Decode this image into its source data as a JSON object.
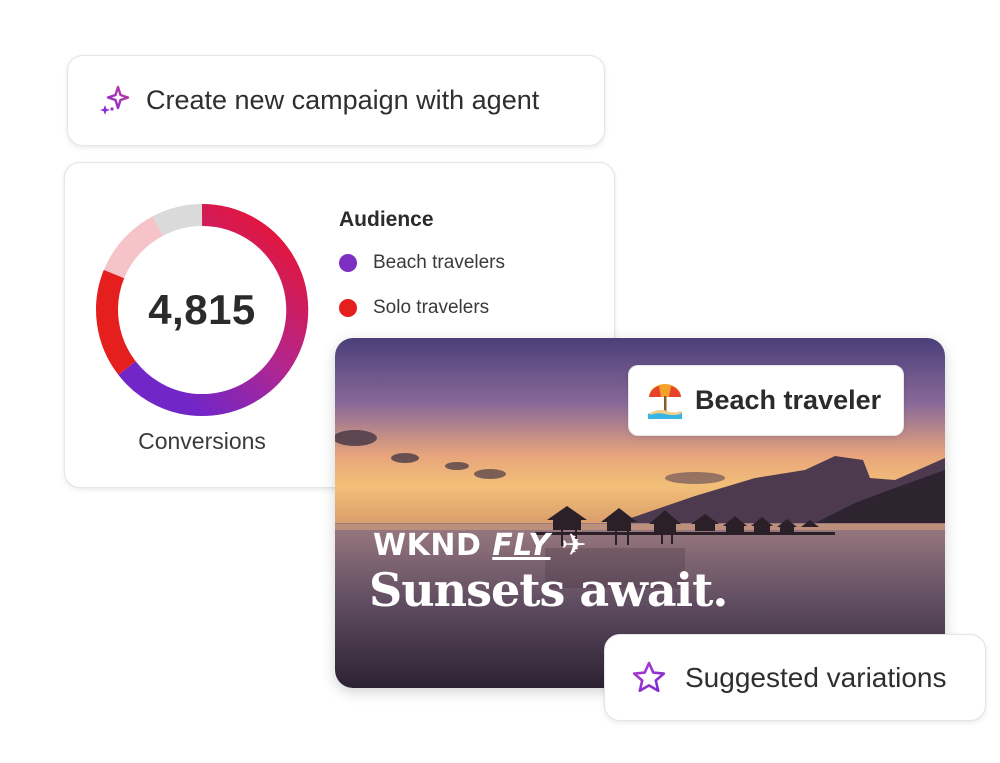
{
  "prompt": {
    "label": "Create new campaign with agent",
    "icon": "sparkle-icon"
  },
  "metrics": {
    "value": "4,815",
    "caption": "Conversions",
    "audience_title": "Audience",
    "legend": [
      {
        "label": "Beach travelers",
        "color": "#7d2fc2"
      },
      {
        "label": "Solo travelers",
        "color": "#e51e1e"
      }
    ]
  },
  "creative": {
    "tag": {
      "label": "Beach traveler",
      "icon": "beach-umbrella-icon"
    },
    "brand_prefix": "WKND ",
    "brand_suffix": "FLY",
    "headline": "Sunsets await."
  },
  "suggestions": {
    "label": "Suggested variations",
    "icon": "star-icon"
  },
  "colors": {
    "accent_purple": "#8a2cd6",
    "red": "#e51e1e",
    "pink": "#f6c3c8",
    "grey": "#dadada"
  }
}
